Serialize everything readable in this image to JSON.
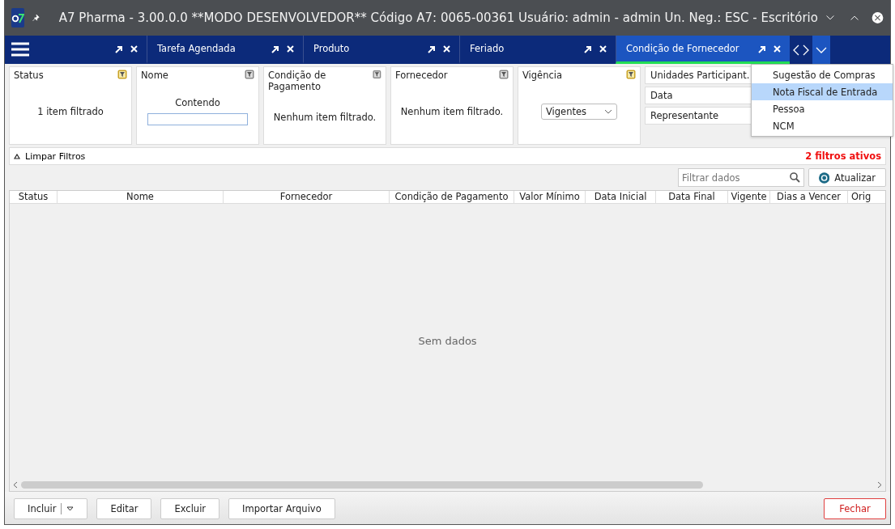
{
  "window": {
    "title": "A7 Pharma - 3.00.0.0 **MODO DESENVOLVEDOR** Código A7: 0065-00361 Usuário: admin - admin Un. Neg.: ESC - Escritório"
  },
  "tabs": [
    {
      "selected": false
    },
    {
      "label": "Tarefa Agendada",
      "selected": false
    },
    {
      "label": "Produto",
      "selected": false
    },
    {
      "label": "Feriado",
      "selected": false
    },
    {
      "label": "Condição de Fornecedor",
      "selected": true
    }
  ],
  "filters": [
    {
      "kind": "summary",
      "title": "Status",
      "active": true,
      "text": "1 item filtrado"
    },
    {
      "kind": "text",
      "title": "Nome",
      "active": false,
      "label": "Contendo"
    },
    {
      "kind": "summary",
      "title": "Condição de Pagamento",
      "active": false,
      "text": "Nenhum item filtrado."
    },
    {
      "kind": "summary",
      "title": "Fornecedor",
      "active": false,
      "text": "Nenhum item filtrado."
    },
    {
      "kind": "select",
      "title": "Vigência",
      "active": true,
      "value": "Vigentes"
    }
  ],
  "more_filters": [
    "Unidades Participant.",
    "Data",
    "Representante"
  ],
  "menu": [
    {
      "label": "Sugestão de Compras",
      "selected": false
    },
    {
      "label": "Nota Fiscal de Entrada",
      "selected": true
    },
    {
      "label": "Pessoa",
      "selected": false
    },
    {
      "label": "NCM",
      "selected": false
    }
  ],
  "clear_filters": "Limpar Filtros",
  "active_filters": "2 filtros ativos",
  "search": {
    "placeholder": "Filtrar dados"
  },
  "refresh": "Atualizar",
  "table": {
    "columns": [
      "Status",
      "Nome",
      "Fornecedor",
      "Condição de Pagamento",
      "Valor Mínimo",
      "Data Inicial",
      "Data Final",
      "Vigente",
      "Dias a Vencer",
      "Orig"
    ],
    "empty": "Sem dados"
  },
  "buttons": [
    {
      "label": "Incluir",
      "kind": "split"
    },
    {
      "label": "Editar",
      "kind": "plain"
    },
    {
      "label": "Excluir",
      "kind": "plain"
    },
    {
      "label": "Importar Arquivo",
      "kind": "plain"
    },
    {
      "label": "Fechar",
      "kind": "close"
    }
  ]
}
